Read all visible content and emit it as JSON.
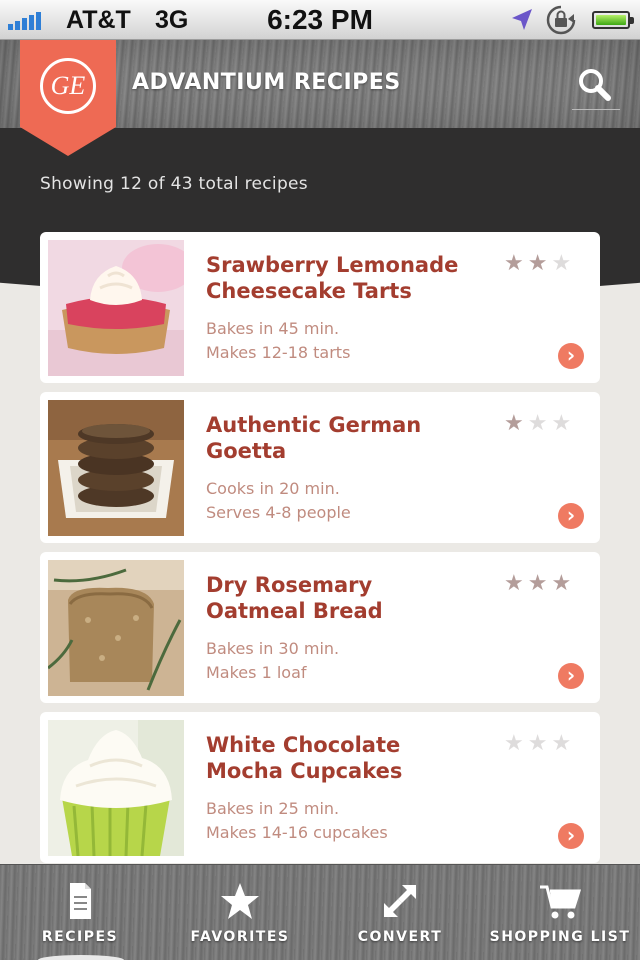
{
  "status_bar": {
    "carrier": "AT&T",
    "network": "3G",
    "time": "6:23 PM"
  },
  "header": {
    "logo_text": "GE",
    "title": "ADVANTIUM RECIPES",
    "search_icon": "search-icon"
  },
  "results": {
    "summary": "Showing 12 of 43 total recipes"
  },
  "recipes": [
    {
      "title": "Srawberry  Lemonade\nCheesecake Tarts",
      "line1": "Bakes in 45 min.",
      "line2": "Makes 12-18 tarts",
      "rating": 2,
      "rating_max": 3,
      "image": "strawberry-cheesecake-tart-photo"
    },
    {
      "title": "Authentic German\nGoetta",
      "line1": "Cooks in 20 min.",
      "line2": "Serves 4-8 people",
      "rating": 1,
      "rating_max": 3,
      "image": "goetta-patties-photo"
    },
    {
      "title": "Dry Rosemary\nOatmeal Bread",
      "line1": "Bakes in 30 min.",
      "line2": "Makes 1 loaf",
      "rating": 3,
      "rating_max": 3,
      "image": "rosemary-oatmeal-bread-photo"
    },
    {
      "title": "White Chocolate\nMocha Cupcakes",
      "line1": "Bakes in 25 min.",
      "line2": "Makes 14-16 cupcakes",
      "rating": 0,
      "rating_max": 3,
      "image": "white-chocolate-cupcake-photo"
    }
  ],
  "tab_bar": {
    "tabs": [
      {
        "label": "RECIPES",
        "icon": "document-icon",
        "active": true
      },
      {
        "label": "FAVORITES",
        "icon": "star-icon",
        "active": false
      },
      {
        "label": "CONVERT",
        "icon": "convert-arrows-icon",
        "active": false
      },
      {
        "label": "SHOPPING LIST",
        "icon": "cart-icon",
        "active": false
      }
    ]
  },
  "colors": {
    "accent": "#ee6a54",
    "title_text": "#a33d2f",
    "meta_text": "#c08b7f",
    "dark_banner": "#2f2e2e"
  }
}
